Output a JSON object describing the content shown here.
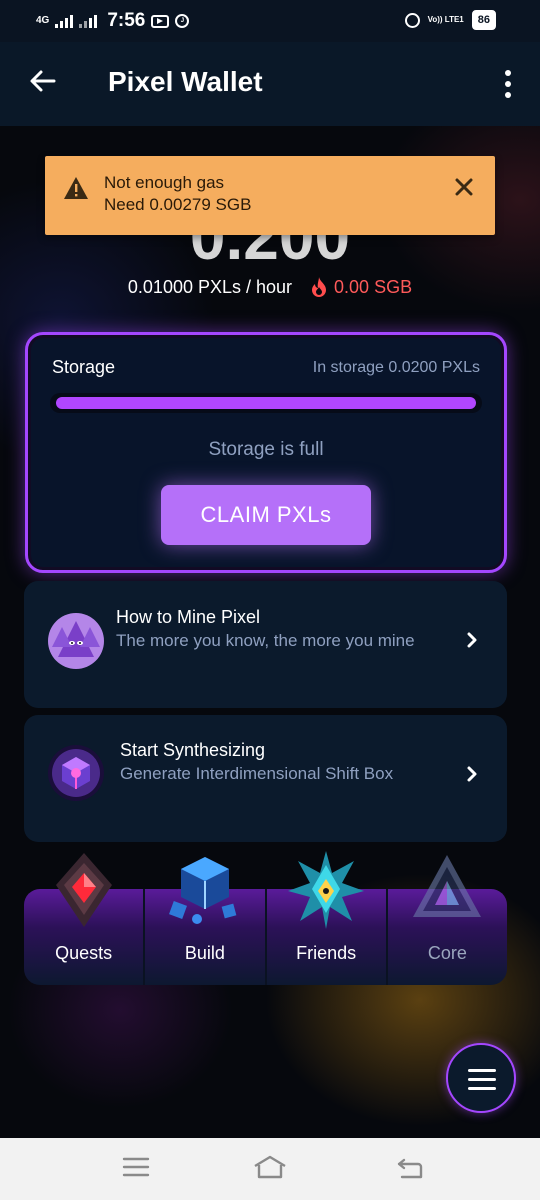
{
  "status_bar": {
    "network": "4G",
    "time": "7:56",
    "volte": "Vo)) LTE1",
    "battery": "86",
    "icons": [
      "signal-icon",
      "youtube-icon",
      "jio-icon",
      "alarm-icon",
      "battery-icon"
    ]
  },
  "app_bar": {
    "title": "Pixel Wallet",
    "back_icon": "arrow-left-icon",
    "menu_icon": "more-vertical-icon"
  },
  "toast": {
    "line1": "Not enough gas",
    "line2": "Need 0.00279 SGB",
    "bg_color": "#f5ad5e"
  },
  "balance": {
    "amount": "0.200",
    "rate": "0.01000 PXLs / hour",
    "gas": "0.00 SGB"
  },
  "storage": {
    "label": "Storage",
    "in_storage": "In storage 0.0200 PXLs",
    "fill_fraction": 1.0,
    "status": "Storage is full",
    "claim_label": "CLAIM PXLs",
    "accent": "#a447ff"
  },
  "cards": [
    {
      "title": "How to Mine Pixel",
      "subtitle": "The more you know, the more you mine",
      "icon": "pyramid-creatures-icon"
    },
    {
      "title": "Start Synthesizing",
      "subtitle": "Generate Interdimensional Shift Box",
      "icon": "glowing-cube-icon"
    }
  ],
  "tabs": [
    {
      "label": "Quests",
      "icon": "red-crystal-icon"
    },
    {
      "label": "Build",
      "icon": "blue-cubes-icon"
    },
    {
      "label": "Friends",
      "icon": "cyan-star-crystal-icon"
    },
    {
      "label": "Core",
      "icon": "prism-triangle-icon"
    }
  ],
  "fab_icon": "hamburger-menu-icon",
  "nav_bar": {
    "icons": [
      "menu-lines-icon",
      "home-icon",
      "back-icon"
    ]
  }
}
